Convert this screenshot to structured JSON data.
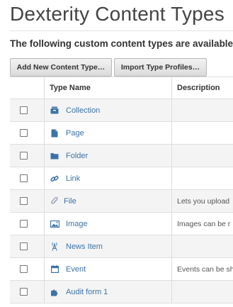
{
  "page": {
    "title": "Dexterity Content Types",
    "description": "The following custom content types are available"
  },
  "toolbar": {
    "add_label": "Add New Content Type…",
    "import_label": "Import Type Profiles…"
  },
  "table": {
    "headers": {
      "select": "",
      "name": "Type Name",
      "description": "Description"
    },
    "rows": [
      {
        "name": "Collection",
        "icon": "collection-icon",
        "description": ""
      },
      {
        "name": "Page",
        "icon": "page-icon",
        "description": ""
      },
      {
        "name": "Folder",
        "icon": "folder-icon",
        "description": ""
      },
      {
        "name": "Link",
        "icon": "link-icon",
        "description": ""
      },
      {
        "name": "File",
        "icon": "paperclip-icon",
        "description": "Lets you upload"
      },
      {
        "name": "Image",
        "icon": "image-icon",
        "description": "Images can be r"
      },
      {
        "name": "News Item",
        "icon": "news-antenna-icon",
        "description": ""
      },
      {
        "name": "Event",
        "icon": "calendar-icon",
        "description": "Events can be sh"
      },
      {
        "name": "Audit form 1",
        "icon": "puzzle-icon",
        "description": ""
      }
    ]
  },
  "colors": {
    "link": "#3b73a8",
    "stripe": "#f4f4f4",
    "border": "#dedede"
  }
}
